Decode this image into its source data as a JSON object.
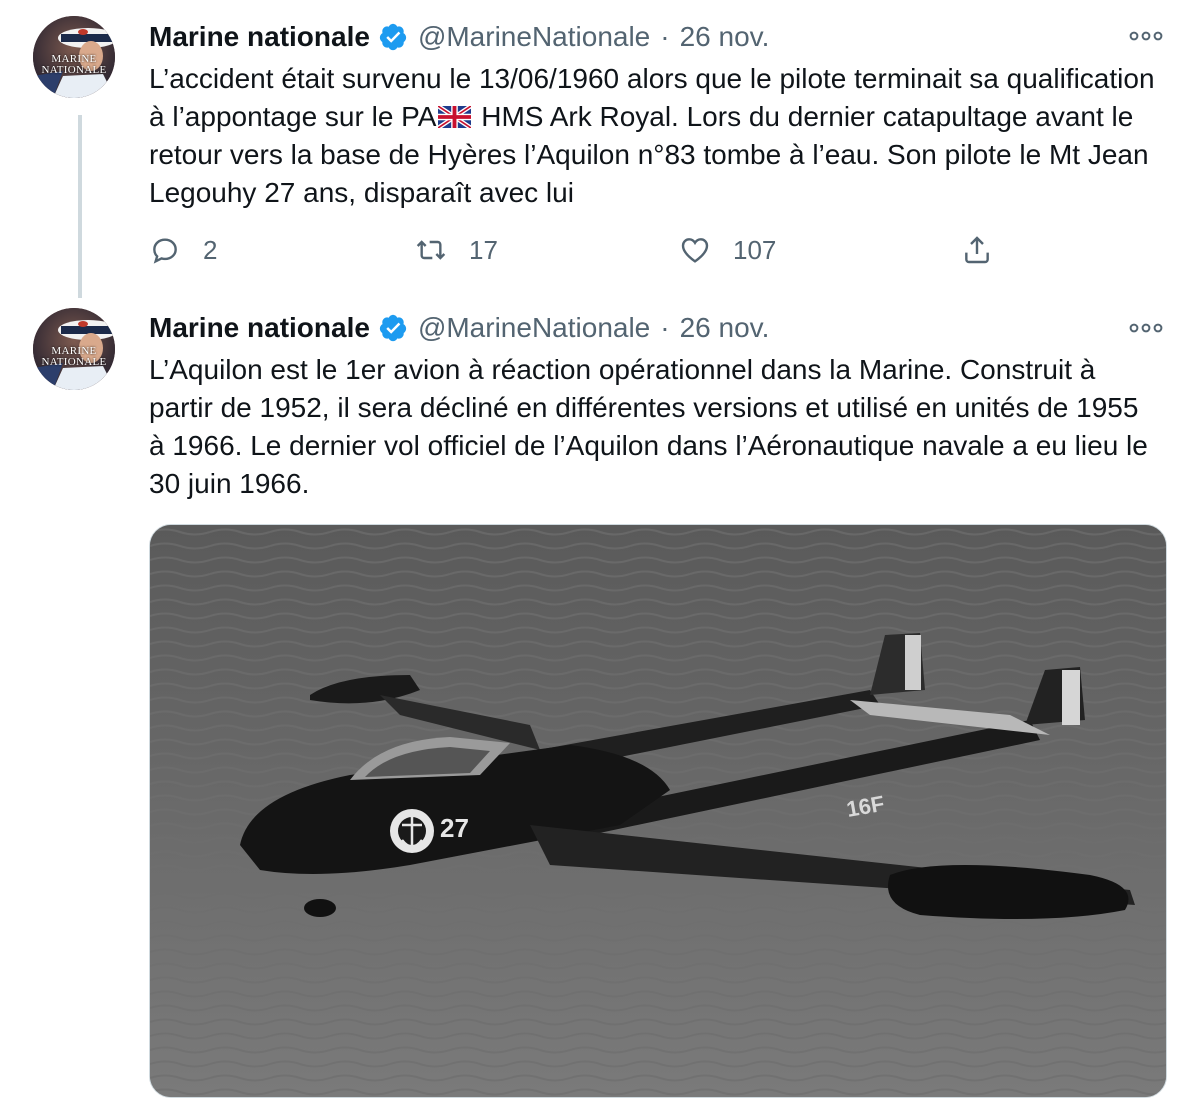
{
  "tweets": [
    {
      "author_name": "Marine nationale",
      "handle": "@MarineNationale",
      "separator": "·",
      "date": "26 nov.",
      "avatar_text_1": "MARINE",
      "avatar_text_2": "NATIONALE",
      "text_before_flag": "L’accident était survenu le 13/06/1960 alors que le pilote terminait sa qualification à l’appontage sur le PA",
      "flag": "uk-flag-emoji",
      "text_after_flag": " HMS Ark Royal. Lors du dernier catapultage avant le retour vers la base de Hyères l’Aquilon n°83 tombe à l’eau. Son pilote le Mt Jean Legouhy 27 ans, disparaît avec lui",
      "reply_count": "2",
      "retweet_count": "17",
      "like_count": "107"
    },
    {
      "author_name": "Marine nationale",
      "handle": "@MarineNationale",
      "separator": "·",
      "date": "26 nov.",
      "avatar_text_1": "MARINE",
      "avatar_text_2": "NATIONALE",
      "text": "L’Aquilon est le 1er avion à réaction opérationnel dans la Marine. Construit à partir de 1952, il sera décliné en différentes versions et utilisé en unités de 1955 à 1966. Le dernier vol officiel de l’Aquilon dans l’Aéronautique navale a eu lieu le 30 juin 1966.",
      "media_markings": {
        "nose_number": "27",
        "tail_code": "16F"
      }
    }
  ],
  "icons": {
    "verified": "verified-badge-icon",
    "more": "more-options-icon",
    "reply": "reply-icon",
    "retweet": "retweet-icon",
    "like": "heart-icon",
    "share": "share-icon"
  },
  "colors": {
    "verified": "#1d9bf0",
    "secondary_text": "#536471",
    "thread_line": "#cfd9de"
  }
}
